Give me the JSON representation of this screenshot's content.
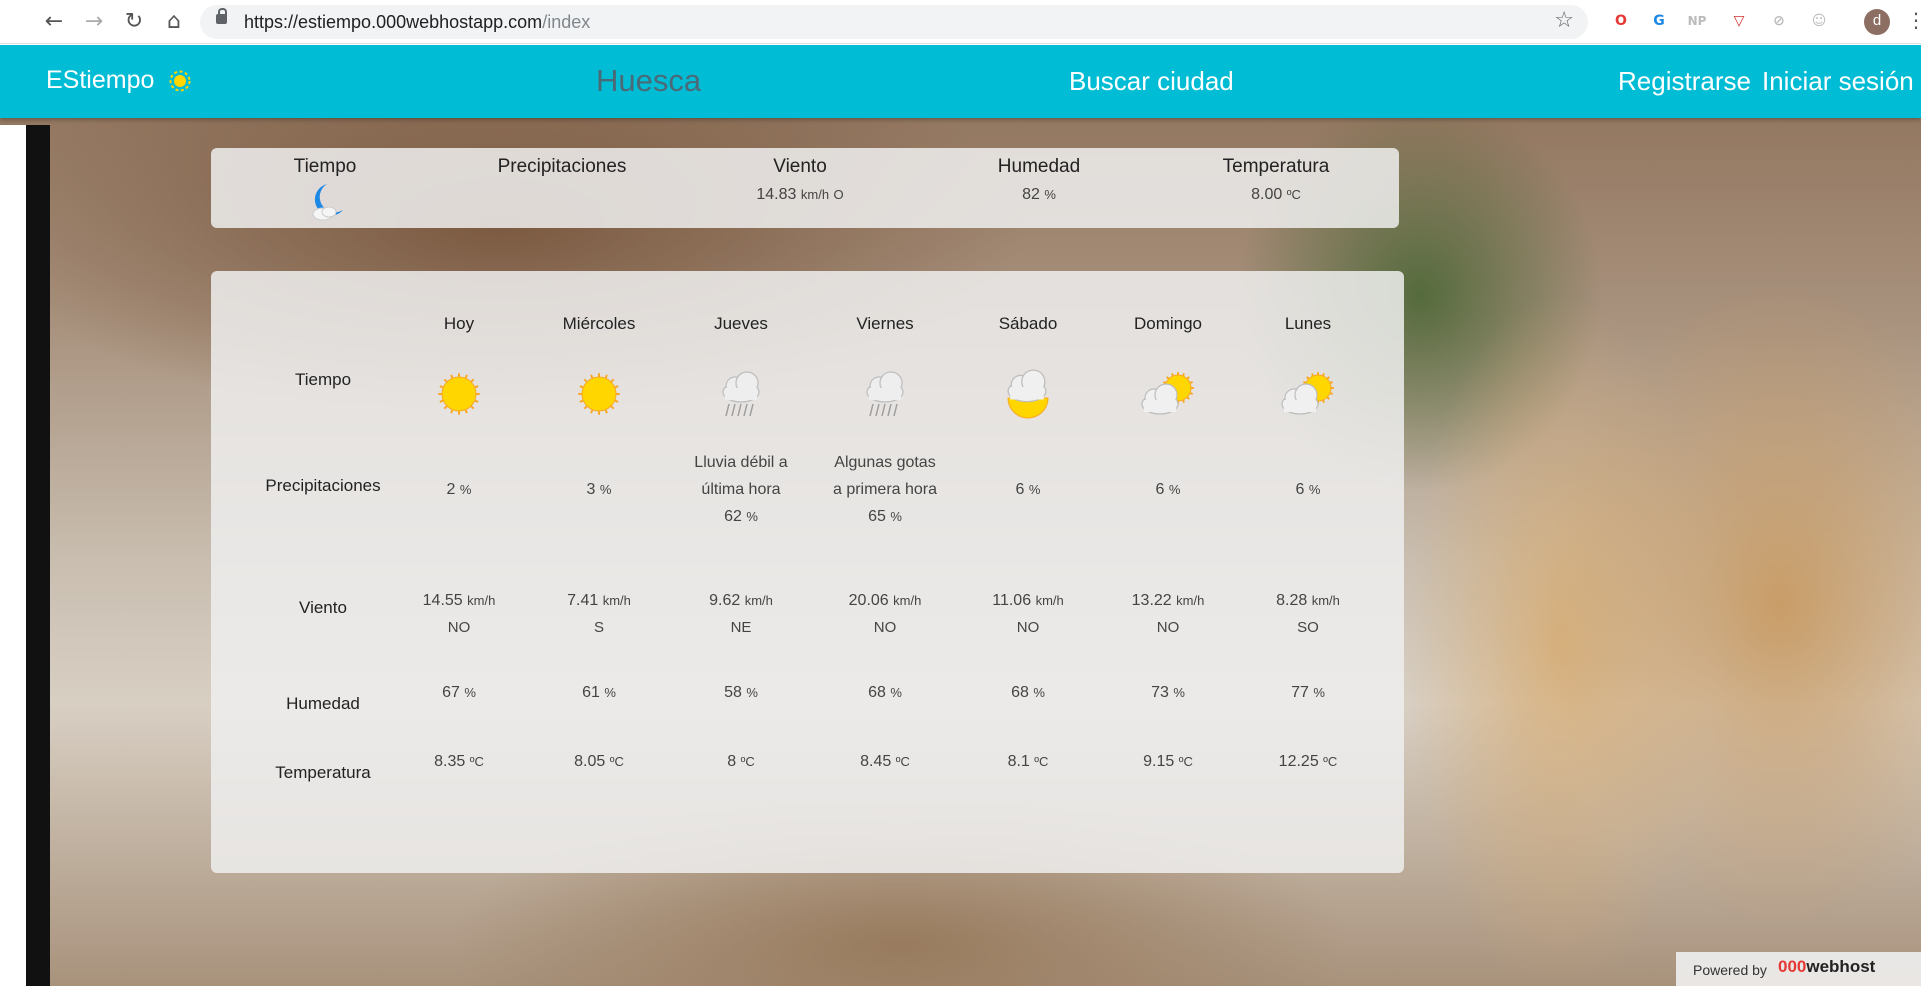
{
  "browser": {
    "url_host": "https://estiempo.000webhostapp.com",
    "url_path": "/index",
    "extensions": [
      "O",
      "G",
      "NP",
      "▽",
      "⊘",
      "☺"
    ],
    "avatar_letter": "d"
  },
  "navbar": {
    "brand": "EStiempo",
    "city": "Huesca",
    "search": "Buscar ciudad",
    "register": "Registrarse",
    "login": "Iniciar sesión"
  },
  "current": {
    "headers": [
      "Tiempo",
      "Precipitaciones",
      "Viento",
      "Humedad",
      "Temperatura"
    ],
    "weather_icon": "moon-cloud-icon",
    "precipitation": "",
    "wind_value": "14.83",
    "wind_unit": "km/h",
    "wind_dir": "O",
    "humidity_value": "82",
    "humidity_unit": "%",
    "temp_value": "8.00",
    "temp_unit": "ºC"
  },
  "forecast": {
    "row_labels": [
      "Tiempo",
      "Precipitaciones",
      "Viento",
      "Humedad",
      "Temperatura"
    ],
    "units": {
      "wind": "km/h",
      "humidity": "%",
      "temp": "ºC",
      "precip": "%"
    },
    "days": [
      {
        "name": "Hoy",
        "icon": "sun-icon",
        "precip_text": "",
        "precip": "2",
        "wind": "14.55",
        "dir": "NO",
        "humidity": "67",
        "temp": "8.35"
      },
      {
        "name": "Miércoles",
        "icon": "sun-icon",
        "precip_text": "",
        "precip": "3",
        "wind": "7.41",
        "dir": "S",
        "humidity": "61",
        "temp": "8.05"
      },
      {
        "name": "Jueves",
        "icon": "rain-cloud-icon",
        "precip_text": "Lluvia débil a última hora",
        "precip": "62",
        "wind": "9.62",
        "dir": "NE",
        "humidity": "58",
        "temp": "8"
      },
      {
        "name": "Viernes",
        "icon": "rain-cloud-icon",
        "precip_text": "Algunas gotas a primera hora",
        "precip": "65",
        "wind": "20.06",
        "dir": "NO",
        "humidity": "68",
        "temp": "8.45"
      },
      {
        "name": "Sábado",
        "icon": "cloud-sun-below-icon",
        "precip_text": "",
        "precip": "6",
        "wind": "11.06",
        "dir": "NO",
        "humidity": "68",
        "temp": "8.1"
      },
      {
        "name": "Domingo",
        "icon": "sun-behind-cloud-icon",
        "precip_text": "",
        "precip": "6",
        "wind": "13.22",
        "dir": "NO",
        "humidity": "73",
        "temp": "9.15"
      },
      {
        "name": "Lunes",
        "icon": "sun-behind-cloud-icon",
        "precip_text": "",
        "precip": "6",
        "wind": "8.28",
        "dir": "SO",
        "humidity": "77",
        "temp": "12.25"
      }
    ]
  },
  "footer": {
    "powered_by": "Powered by",
    "host_logo_a": "000",
    "host_logo_b": "webhost"
  },
  "colors": {
    "navbar": "#00bcd4",
    "sun": "#ffd600",
    "cloud": "#e0e0e0"
  }
}
